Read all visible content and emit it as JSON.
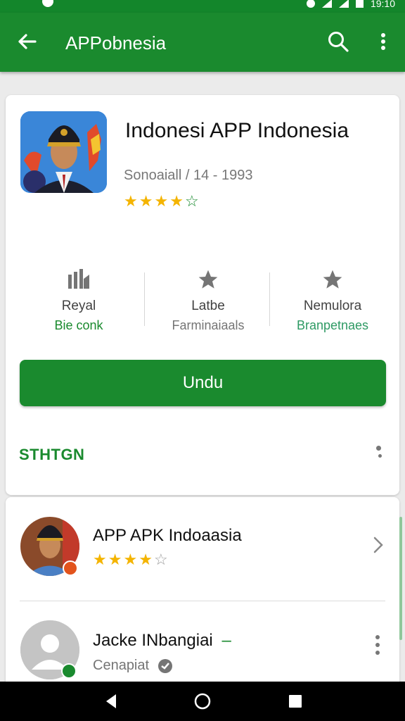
{
  "status_bar": {
    "time": "19:10"
  },
  "app_bar": {
    "title": "APPobnesia"
  },
  "app": {
    "name": "Indonesi APP Indonesia",
    "meta": "Sonoaiall / 14 - 1993",
    "rating_stars": 4,
    "rating_max": 5
  },
  "stats": [
    {
      "label": "Reyal",
      "sub": "Bie conk",
      "icon": "bar-chart-icon"
    },
    {
      "label": "Latbe",
      "sub": "Farminaiaals",
      "icon": "star-icon"
    },
    {
      "label": "Nemulora",
      "sub": "Branpetnaes",
      "icon": "star-icon"
    }
  ],
  "install_button": "Undu",
  "section": {
    "label": "STHTGN"
  },
  "list": [
    {
      "title": "APP APK Indoaasia",
      "rating_stars": 4,
      "rating_max": 5,
      "action": "chevron-right-icon"
    },
    {
      "title": "Jacke INbangiai",
      "title_suffix": "–",
      "sub": "Cenapiat",
      "action": "more-vert-icon"
    }
  ],
  "colors": {
    "primary": "#1a8a2e",
    "star": "#f4b400",
    "text_primary": "#111111",
    "text_secondary": "#757575"
  }
}
